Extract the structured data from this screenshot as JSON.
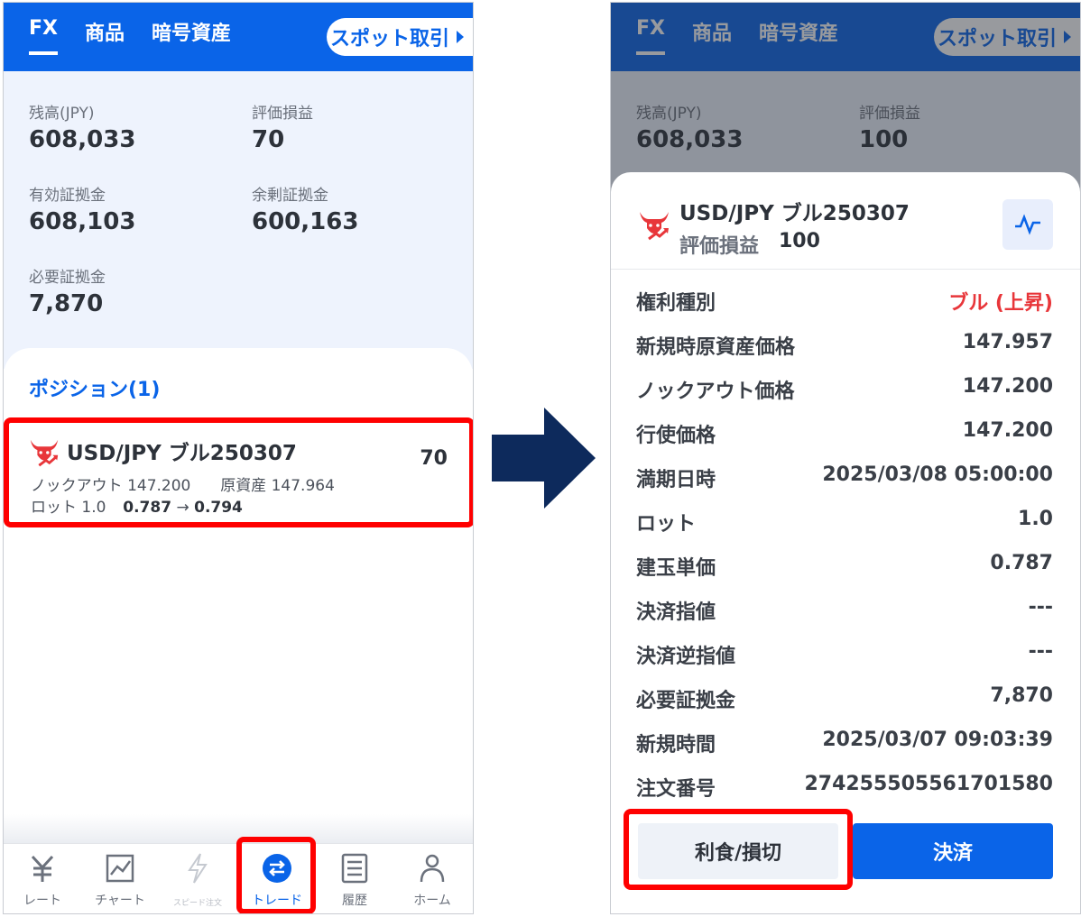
{
  "header": {
    "tabs": [
      {
        "label": "FX"
      },
      {
        "label": "商品"
      },
      {
        "label": "暗号資産"
      }
    ],
    "spot_label": "スポット取引"
  },
  "left": {
    "summary": {
      "balance_label": "残高(JPY)",
      "balance_value": "608,033",
      "pnl_label": "評価損益",
      "pnl_value": "70",
      "effective_label": "有効証拠金",
      "effective_value": "608,103",
      "surplus_label": "余剰証拠金",
      "surplus_value": "600,163",
      "required_label": "必要証拠金",
      "required_value": "7,870"
    },
    "positions_title": "ポジション(1)",
    "position": {
      "name": "USD/JPY ブル250307",
      "pnl": "70",
      "knockout_label": "ノックアウト",
      "knockout_value": "147.200",
      "underlying_label": "原資産",
      "underlying_value": "147.964",
      "lot_label": "ロット",
      "lot_value": "1.0",
      "price_from": "0.787",
      "arrow": "→",
      "price_to": "0.794"
    },
    "nav": [
      {
        "label": "レート",
        "icon": "yen-icon"
      },
      {
        "label": "チャート",
        "icon": "chart-icon"
      },
      {
        "label": "スピード注文",
        "icon": "lightning-icon"
      },
      {
        "label": "トレード",
        "icon": "trade-icon"
      },
      {
        "label": "履歴",
        "icon": "history-icon"
      },
      {
        "label": "ホーム",
        "icon": "person-icon"
      }
    ]
  },
  "right": {
    "summary": {
      "balance_label": "残高(JPY)",
      "balance_value": "608,033",
      "pnl_label": "評価損益",
      "pnl_value": "100"
    },
    "detail": {
      "name": "USD/JPY ブル250307",
      "pnl_label": "評価損益",
      "pnl_value": "100",
      "rows": [
        {
          "label": "権利種別",
          "value": "ブル (上昇)"
        },
        {
          "label": "新規時原資産価格",
          "value": "147.957"
        },
        {
          "label": "ノックアウト価格",
          "value": "147.200"
        },
        {
          "label": "行使価格",
          "value": "147.200"
        },
        {
          "label": "満期日時",
          "value": "2025/03/08 05:00:00"
        },
        {
          "label": "ロット",
          "value": "1.0"
        },
        {
          "label": "建玉単価",
          "value": "0.787"
        },
        {
          "label": "決済指値",
          "value": "---"
        },
        {
          "label": "決済逆指値",
          "value": "---"
        },
        {
          "label": "必要証拠金",
          "value": "7,870"
        },
        {
          "label": "新規時間",
          "value": "2025/03/07 09:03:39"
        },
        {
          "label": "注文番号",
          "value": "274255505561701580"
        }
      ],
      "tp_sl_label": "利食/損切",
      "settle_label": "決済"
    }
  },
  "colors": {
    "brand_blue": "#0a64e8",
    "highlight_red": "#ff0000",
    "bull_red": "#e8363a",
    "arrow_navy": "#0d2a5c"
  }
}
